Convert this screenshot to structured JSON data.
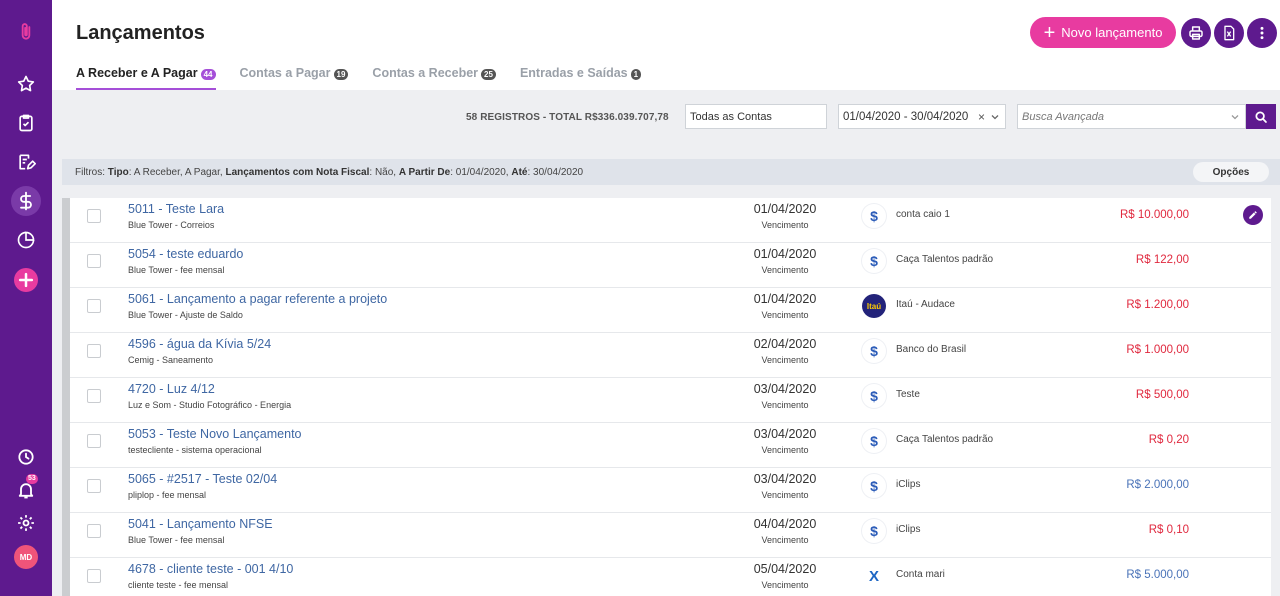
{
  "sidebar": {
    "icons": [
      "logo-icon",
      "star-icon",
      "clipboard-check-icon",
      "edit-note-icon",
      "dollar-icon",
      "pie-chart-icon",
      "plus-icon",
      "clock-icon",
      "bell-icon",
      "gear-icon"
    ],
    "notification_count": "53",
    "avatar_initials": "MD"
  },
  "header": {
    "title": "Lançamentos",
    "new_button_label": "Novo lançamento"
  },
  "tabs": [
    {
      "label": "A Receber e A Pagar",
      "count": "44",
      "active": true
    },
    {
      "label": "Contas a Pagar",
      "count": "19",
      "active": false
    },
    {
      "label": "Contas a Receber",
      "count": "25",
      "active": false
    },
    {
      "label": "Entradas e Saídas",
      "count": "1",
      "active": false
    }
  ],
  "toolbar": {
    "summary": "58 REGISTROS - TOTAL R$336.039.707,78",
    "account_select": "Todas as Contas",
    "date_range": "01/04/2020 - 30/04/2020",
    "date_clear": "×",
    "search_placeholder": "Busca Avançada"
  },
  "filters": {
    "label": "Filtros:",
    "tipo_label": "Tipo",
    "tipo_value": ": A Receber, A Pagar, ",
    "nf_label": "Lançamentos com Nota Fiscal",
    "nf_value": ": Não, ",
    "from_label": "A Partir De",
    "from_value": ": 01/04/2020, ",
    "to_label": "Até",
    "to_value": ": 30/04/2020",
    "options_label": "Opções"
  },
  "rows": [
    {
      "title": "5011 - Teste Lara",
      "subtitle": "Blue Tower - Correios",
      "date": "01/04/2020",
      "date_label": "Vencimento",
      "bank": "$",
      "account": "conta caio 1",
      "amount": "R$ 10.000,00"
    },
    {
      "title": "5054 - teste eduardo",
      "subtitle": "Blue Tower - fee mensal",
      "date": "01/04/2020",
      "date_label": "Vencimento",
      "bank": "$",
      "account": "Caça Talentos padrão",
      "amount": "R$ 122,00"
    },
    {
      "title": "5061 - Lançamento a pagar referente a projeto",
      "subtitle": "Blue Tower - Ajuste de Saldo",
      "date": "01/04/2020",
      "date_label": "Vencimento",
      "bank": "Itaú",
      "account": "Itaú - Audace",
      "amount": "R$ 1.200,00"
    },
    {
      "title": "4596 - água da Kívia 5/24",
      "subtitle": "Cemig - Saneamento",
      "date": "02/04/2020",
      "date_label": "Vencimento",
      "bank": "$",
      "account": "Banco do Brasil",
      "amount": "R$ 1.000,00"
    },
    {
      "title": "4720 - Luz 4/12",
      "subtitle": "Luz e Som - Studio Fotográfico - Energia",
      "date": "03/04/2020",
      "date_label": "Vencimento",
      "bank": "$",
      "account": "Teste",
      "amount": "R$ 500,00"
    },
    {
      "title": "5053 - Teste Novo Lançamento",
      "subtitle": "testecliente - sistema operacional",
      "date": "03/04/2020",
      "date_label": "Vencimento",
      "bank": "$",
      "account": "Caça Talentos padrão",
      "amount": "R$ 0,20"
    },
    {
      "title": "5065 - #2517 - Teste 02/04",
      "subtitle": "pliplop - fee mensal",
      "date": "03/04/2020",
      "date_label": "Vencimento",
      "bank": "$",
      "account": "iClips",
      "amount": "R$ 2.000,00"
    },
    {
      "title": "5041 - Lançamento NFSE",
      "subtitle": "Blue Tower - fee mensal",
      "date": "04/04/2020",
      "date_label": "Vencimento",
      "bank": "$",
      "account": "iClips",
      "amount": "R$ 0,10"
    },
    {
      "title": "4678 - cliente teste - 001 4/10",
      "subtitle": "cliente teste - fee mensal",
      "date": "05/04/2020",
      "date_label": "Vencimento",
      "bank": "X",
      "account": "Conta mari",
      "amount": "R$ 5.000,00"
    }
  ],
  "colors": {
    "brand": "#5e1a8e",
    "accent": "#e83ba0",
    "negative": "#e0283e",
    "positive": "#4a73b8"
  }
}
